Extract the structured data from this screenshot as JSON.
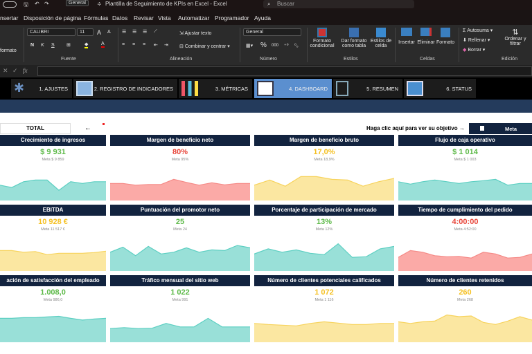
{
  "titlebar": {
    "format_box": "General",
    "title": "Plantilla de Seguimiento de KPIs en Excel  -  Excel",
    "search_placeholder": "Buscar"
  },
  "menu": [
    "nsertar",
    "Disposición de página",
    "Fórmulas",
    "Datos",
    "Revisar",
    "Vista",
    "Automatizar",
    "Programador",
    "Ayuda"
  ],
  "ribbon": {
    "clip_label": "formato",
    "font": "CALIBRI",
    "font_size": "11",
    "bold": "N",
    "italic": "K",
    "underline": "S",
    "wrap": "Ajustar texto",
    "merge": "Combinar y centrar",
    "number_format": "General",
    "percent": "%",
    "thousands": "000",
    "cond_format": [
      "Formato",
      "condicional"
    ],
    "table_format": [
      "Dar formato",
      "como tabla"
    ],
    "cell_styles": [
      "Estilos de",
      "celda"
    ],
    "insert": "Insertar",
    "delete": "Eliminar",
    "format": "Formato",
    "autosum": "Autosuma",
    "fill": "Rellenar",
    "clear": "Borrar",
    "sort": [
      "Ordenar y",
      "filtrar"
    ],
    "groups": [
      "Fuente",
      "Alineación",
      "Número",
      "Estilos",
      "Celdas",
      "Edición"
    ]
  },
  "formula_bar": {
    "fx": "fx",
    "value": ""
  },
  "nav": [
    "1. AJUSTES",
    "2. REGISTRO DE INDICADORES",
    "3. MÉTRICAS",
    "4. DASHBOARD",
    "5. RESUMEN",
    "6. STATUS"
  ],
  "controls": {
    "total": "TOTAL",
    "back_arrow": "←",
    "hint": "Haga clic aquí para ver su objetivo →",
    "meta_toggle": "Meta"
  },
  "colors": {
    "green": "#5cb947",
    "red": "#e8463a",
    "yellow": "#f5c022",
    "teal_fill": "#99e0d8",
    "teal_line": "#5ccfc2",
    "red_fill": "#fbaaa7",
    "red_line": "#f58a87",
    "yellow_fill": "#fbe7a1",
    "yellow_line": "#f7d35c",
    "header": "#12233f"
  },
  "cards": [
    {
      "title": "Crecimiento de ingresos",
      "value": "$ 9 931",
      "meta": "Meta  $ 9 859",
      "status": "green",
      "chart": "teal",
      "trend": [
        45,
        38,
        55,
        60,
        60,
        30,
        55,
        50,
        55,
        55
      ]
    },
    {
      "title": "Margen de beneficio neto",
      "value": "80%",
      "meta": "Meta  95%",
      "status": "red",
      "chart": "red",
      "trend": [
        50,
        50,
        45,
        47,
        47,
        62,
        53,
        45,
        52,
        46,
        50,
        50
      ]
    },
    {
      "title": "Margen de beneficio bruto",
      "value": "17,0%",
      "meta": "Meta  18,9%",
      "status": "yellow",
      "chart": "yellow",
      "trend": [
        45,
        60,
        42,
        70,
        70,
        62,
        60,
        42,
        55,
        65
      ]
    },
    {
      "title": "Flujo de caja operativo",
      "value": "$ 1 014",
      "meta": "Meta  $ 1 003",
      "status": "green",
      "chart": "teal",
      "trend": [
        55,
        48,
        55,
        60,
        55,
        50,
        55,
        58,
        62,
        45,
        50,
        50
      ]
    },
    {
      "title": "EBITDA",
      "value": "10 928 €",
      "meta": "Meta  11 517 €",
      "status": "yellow",
      "chart": "yellow",
      "trend": [
        60,
        60,
        55,
        57,
        48,
        52,
        52,
        52,
        54,
        58
      ]
    },
    {
      "title": "Puntuación del promotor neto",
      "value": "25",
      "meta": "Meta  24",
      "status": "green",
      "chart": "teal",
      "trend": [
        55,
        70,
        45,
        72,
        50,
        55,
        68,
        55,
        62,
        60,
        75,
        68
      ]
    },
    {
      "title": "Porcentaje de participación de mercado",
      "value": "13%",
      "meta": "Meta  12%",
      "status": "green",
      "chart": "teal",
      "trend": [
        50,
        65,
        55,
        62,
        52,
        48,
        80,
        40,
        42,
        65,
        72
      ]
    },
    {
      "title": "Tiempo de cumplimiento del pedido",
      "value": "4:00:00",
      "meta": "Meta  4:52:00",
      "status": "red",
      "chart": "red",
      "trend": [
        40,
        60,
        55,
        45,
        42,
        43,
        38,
        55,
        50,
        38,
        40,
        50
      ]
    },
    {
      "title": "ación de satisfacción del empleado",
      "value": "1.008,0",
      "meta": "Meta  986,0",
      "status": "green",
      "chart": "teal",
      "trend": [
        70,
        70,
        72,
        72,
        74,
        76,
        70,
        65,
        68,
        70
      ]
    },
    {
      "title": "Tráfico mensual del sitio web",
      "value": "1 022",
      "meta": "Meta  991",
      "status": "green",
      "chart": "teal",
      "trend": [
        40,
        43,
        40,
        41,
        55,
        45,
        45,
        70,
        45,
        45,
        45
      ]
    },
    {
      "title": "Número de clientes potenciales calificados",
      "value": "1 072",
      "meta": "Meta  1 116",
      "status": "yellow",
      "chart": "yellow",
      "trend": [
        55,
        52,
        50,
        48,
        55,
        60,
        56,
        52,
        52,
        55,
        55
      ]
    },
    {
      "title": "Número de clientes retenidos",
      "value": "260",
      "meta": "Meta  268",
      "status": "yellow",
      "chart": "yellow",
      "trend": [
        60,
        55,
        60,
        62,
        80,
        75,
        77,
        58,
        52,
        62,
        75,
        65
      ]
    }
  ]
}
